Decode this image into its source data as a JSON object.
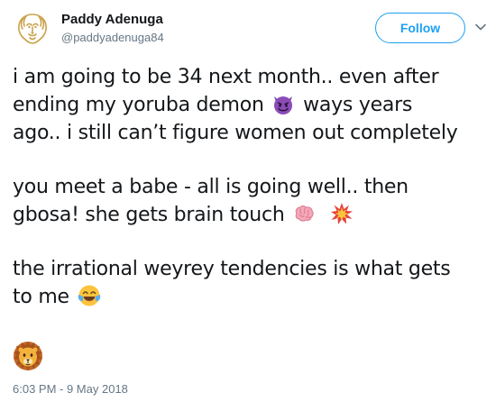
{
  "user": {
    "display_name": "Paddy Adenuga",
    "handle": "@paddyadenuga84",
    "avatar_icon": "gold-lion-logo"
  },
  "follow_button": {
    "label": "Follow",
    "color": "#1da1f2"
  },
  "menu": {
    "icon": "chevron-down-icon"
  },
  "tweet": {
    "paragraph_1": {
      "line_1": "i am going to be 34 next month.. even after",
      "line_2_before_emoji": "ending my yoruba demon ",
      "line_2_emoji": "smiling-face-with-horns-emoji",
      "line_2_after_emoji": " ways years",
      "line_3": "ago.. i still can’t figure women out completely"
    },
    "paragraph_2": {
      "line_1": "you meet a babe - all is going well.. then",
      "line_2": "gbosa! she gets brain touch ",
      "line_2_emojis": [
        "brain-emoji",
        "collision-emoji"
      ]
    },
    "paragraph_3": {
      "line_1": "the irrational weyrey tendencies is what gets",
      "line_2": "to me ",
      "line_2_emoji": "face-with-tears-of-joy-emoji"
    },
    "trailing_emoji": "lion-face-emoji"
  },
  "timestamp": "6:03 PM - 9 May 2018",
  "colors": {
    "text": "#14171a",
    "secondary_text": "#657786",
    "accent": "#1da1f2"
  }
}
